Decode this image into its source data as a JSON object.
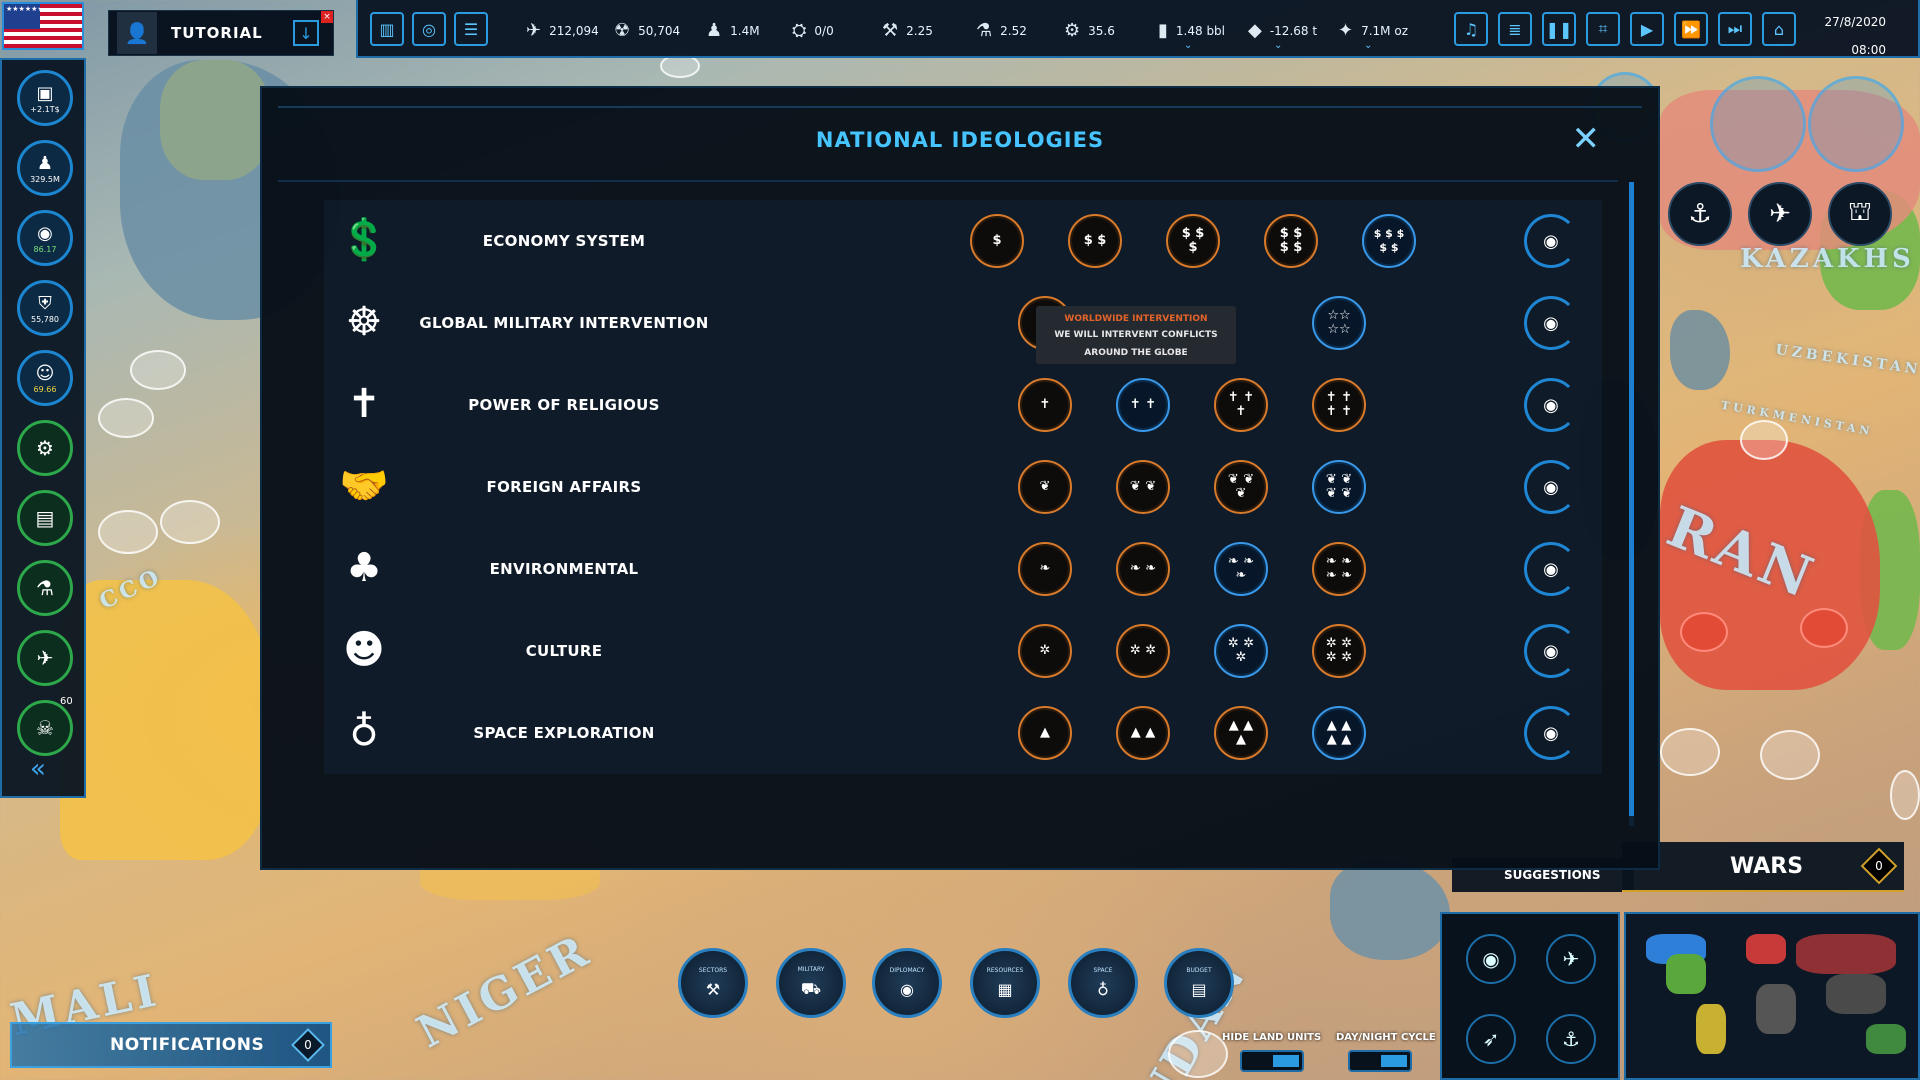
{
  "tutorial": {
    "label": "TUTORIAL"
  },
  "stats": [
    {
      "icon": "missile-icon",
      "glyph": "✈",
      "value": "212,094"
    },
    {
      "icon": "nuclear-icon",
      "glyph": "☢",
      "value": "50,704"
    },
    {
      "icon": "population-icon",
      "glyph": "♟",
      "value": "1.4M"
    },
    {
      "icon": "satellite-icon",
      "glyph": "⛭",
      "value": "0/0"
    },
    {
      "icon": "industry-icon",
      "glyph": "⚒",
      "value": "2.25"
    },
    {
      "icon": "flask-icon",
      "glyph": "⚗",
      "value": "2.52"
    },
    {
      "icon": "gear-resource-icon",
      "glyph": "⚙",
      "value": "35.6"
    },
    {
      "icon": "oil-icon",
      "glyph": "▮",
      "value": "1.48 bbl"
    },
    {
      "icon": "ore-icon",
      "glyph": "◆",
      "value": "-12.68 t"
    },
    {
      "icon": "gold-icon",
      "glyph": "✦",
      "value": "7.1M oz"
    }
  ],
  "datetime": {
    "date": "27/8/2020",
    "time": "08:00"
  },
  "leftbar": [
    {
      "name": "treasury",
      "glyph": "▣",
      "value": "+2.1T$"
    },
    {
      "name": "population",
      "glyph": "♟",
      "value": "329.5M"
    },
    {
      "name": "approval",
      "glyph": "◉",
      "value": "86.17"
    },
    {
      "name": "military-power",
      "glyph": "⛨",
      "value": "55,780"
    },
    {
      "name": "happiness",
      "glyph": "☺",
      "value": "69.66"
    }
  ],
  "leftbar_badge": "60",
  "modal": {
    "title": "NATIONAL IDEOLOGIES",
    "rows": [
      {
        "name": "ECONOMY SYSTEM",
        "icon": "economy-icon",
        "glyph": "💲",
        "options": [
          "$",
          "$ $",
          "$ $\n$",
          "$ $\n$ $",
          "$ $ $\n$ $"
        ],
        "selected": 4
      },
      {
        "name": "GLOBAL MILITARY INTERVENTION",
        "icon": "military-intervention-icon",
        "glyph": "☸",
        "options": [
          "☆",
          "☆☆\n☆☆"
        ],
        "selected": 1
      },
      {
        "name": "POWER OF RELIGIOUS",
        "icon": "religion-icon",
        "glyph": "✝",
        "options": [
          "✝",
          "✝ ✝",
          "✝ ✝\n✝",
          "✝ ✝\n✝ ✝"
        ],
        "selected": 1
      },
      {
        "name": "FOREIGN AFFAIRS",
        "icon": "handshake-icon",
        "glyph": "🤝",
        "options": [
          "❦",
          "❦ ❦",
          "❦ ❦\n❦",
          "❦ ❦\n❦ ❦"
        ],
        "selected": 3
      },
      {
        "name": "ENVIRONMENTAL",
        "icon": "tree-icon",
        "glyph": "♣",
        "options": [
          "❧",
          "❧ ❧",
          "❧ ❧\n❧",
          "❧ ❧\n❧ ❧"
        ],
        "selected": 2
      },
      {
        "name": "CULTURE",
        "icon": "theater-masks-icon",
        "glyph": "☻",
        "options": [
          "✲",
          "✲ ✲",
          "✲ ✲\n✲",
          "✲ ✲\n✲ ✲"
        ],
        "selected": 2
      },
      {
        "name": "SPACE EXPLORATION",
        "icon": "planet-icon",
        "glyph": "♁",
        "options": [
          "▲",
          "▲ ▲",
          "▲ ▲\n▲",
          "▲ ▲\n▲ ▲"
        ],
        "selected": 3
      }
    ],
    "tooltip": {
      "title": "WORLDWIDE INTERVENTION",
      "description": "WE WILL INTERVENT CONFLICTS AROUND THE GLOBE"
    }
  },
  "right": {
    "suggestions": "SUGGESTIONS",
    "wars": "WARS",
    "wars_count": "0"
  },
  "bottom": {
    "notifications": "NOTIFICATIONS",
    "notifications_count": "0",
    "menu": [
      {
        "label": "SECTORS",
        "glyph": "⚒"
      },
      {
        "label": "MILITARY",
        "glyph": "⛟"
      },
      {
        "label": "DIPLOMACY",
        "glyph": "◉"
      },
      {
        "label": "RESOURCES",
        "glyph": "▦"
      },
      {
        "label": "SPACE",
        "glyph": "♁"
      },
      {
        "label": "BUDGET",
        "glyph": "▤"
      }
    ],
    "hide_land_units": "HIDE LAND UNITS",
    "day_night_cycle": "DAY/NIGHT CYCLE"
  },
  "map_labels": [
    "KAZAKHS",
    "UZBEKISTAN",
    "TURKMENISTAN",
    "RAN",
    "MALI",
    "NIGER",
    "CCO",
    "UDAN"
  ],
  "colors": {
    "accent": "#46c4ff",
    "orange": "#d77a2c",
    "selected": "#3a98e8",
    "wars_gold": "#d1a12a"
  }
}
